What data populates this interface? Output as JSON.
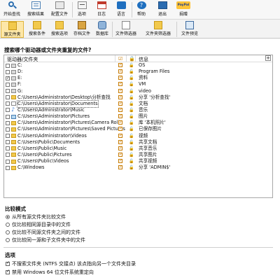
{
  "toolbar": {
    "items": [
      {
        "label": "开始查找",
        "icon": "search-icon"
      },
      {
        "label": "搜索结果",
        "icon": "results-icon"
      },
      {
        "label": "配置文件",
        "icon": "profile-icon"
      },
      {
        "label": "选项",
        "icon": "options-icon"
      },
      {
        "label": "日志",
        "icon": "log-icon"
      },
      {
        "label": "语言",
        "icon": "language-icon"
      },
      {
        "label": "帮助",
        "icon": "help-icon"
      },
      {
        "label": "退出",
        "icon": "exit-icon"
      },
      {
        "label": "捐赠",
        "icon": "donate-icon"
      }
    ],
    "help_badge": "?",
    "donate_badge": "PayPal"
  },
  "subtoolbar": {
    "items": [
      {
        "label": "源文件夹",
        "icon": "source-folder-icon",
        "active": true
      },
      {
        "label": "搜索条件",
        "icon": "criteria-icon"
      },
      {
        "label": "搜索选项",
        "icon": "search-options-icon"
      },
      {
        "label": "存档文件",
        "icon": "archive-icon"
      },
      {
        "label": "数据库",
        "icon": "database-icon"
      },
      {
        "label": "文件筛选器",
        "icon": "file-filter-icon"
      },
      {
        "label": "文件夹筛选器",
        "icon": "folder-filter-icon"
      },
      {
        "label": "文件预览",
        "icon": "preview-icon"
      }
    ]
  },
  "question": "搜索哪个驱动器或文件夹重复的文件?",
  "list": {
    "col_path": "驱动器/文件夹",
    "col_info": "信息",
    "add_symbol": "+",
    "rows": [
      {
        "path": "C:",
        "info": "OS",
        "icon": "drive",
        "checked": false
      },
      {
        "path": "D:",
        "info": "Program Files",
        "icon": "drive",
        "checked": false
      },
      {
        "path": "E:",
        "info": "资料",
        "icon": "drive",
        "checked": true
      },
      {
        "path": "F:",
        "info": "VM",
        "icon": "drive",
        "checked": false
      },
      {
        "path": "G:",
        "info": "video",
        "icon": "drive",
        "checked": false
      },
      {
        "path": "C:\\Users\\Administrator\\Desktop\\分析查找",
        "info": "分享 '分析查找'",
        "icon": "folder",
        "checked": false
      },
      {
        "path": "C:\\Users\\Administrator\\Documents",
        "info": "文档",
        "icon": "doc",
        "checked": false,
        "selected": true
      },
      {
        "path": "C:\\Users\\Administrator\\Music",
        "info": "音乐",
        "icon": "music",
        "checked": false
      },
      {
        "path": "C:\\Users\\Administrator\\Pictures",
        "info": "图片",
        "icon": "pic",
        "checked": false
      },
      {
        "path": "C:\\Users\\Administrator\\Pictures\\Camera Roll",
        "info": "库 '本机照片'",
        "icon": "folder",
        "checked": false
      },
      {
        "path": "C:\\Users\\Administrator\\Pictures\\Saved Pictures",
        "info": "已保存图片",
        "icon": "folder",
        "checked": false
      },
      {
        "path": "C:\\Users\\Administrator\\Videos",
        "info": "视频",
        "icon": "folder",
        "checked": false
      },
      {
        "path": "C:\\Users\\Public\\Documents",
        "info": "共享文档",
        "icon": "folder",
        "checked": false
      },
      {
        "path": "C:\\Users\\Public\\Music",
        "info": "共享音乐",
        "icon": "folder",
        "checked": false
      },
      {
        "path": "C:\\Users\\Public\\Pictures",
        "info": "共享图片",
        "icon": "folder",
        "checked": false
      },
      {
        "path": "C:\\Users\\Public\\Videos",
        "info": "共享视频",
        "icon": "folder",
        "checked": false
      },
      {
        "path": "C:\\Windows",
        "info": "分享 'ADMIN$'",
        "icon": "folder",
        "checked": false
      }
    ]
  },
  "compare": {
    "title": "比较模式",
    "options": [
      {
        "label": "从所有源文件夹比较文件",
        "selected": true
      },
      {
        "label": "仅比较相同源目录中的文件",
        "selected": false
      },
      {
        "label": "仅比较不同源文件夹之间的文件",
        "selected": false
      },
      {
        "label": "仅比较同一源和子文件夹中的文件",
        "selected": false
      }
    ]
  },
  "options": {
    "title": "选项",
    "items": [
      {
        "label": "不搜索文件夹 (NTFS 交接点) 该点指向另一个文件夹目录",
        "checked": true
      },
      {
        "label": "禁用 Windows 64 位文件系统重定向",
        "checked": true
      }
    ]
  },
  "colors": {
    "accent": "#e0b43c",
    "active_bg": "#fde7a8",
    "check": "#c77b00"
  }
}
